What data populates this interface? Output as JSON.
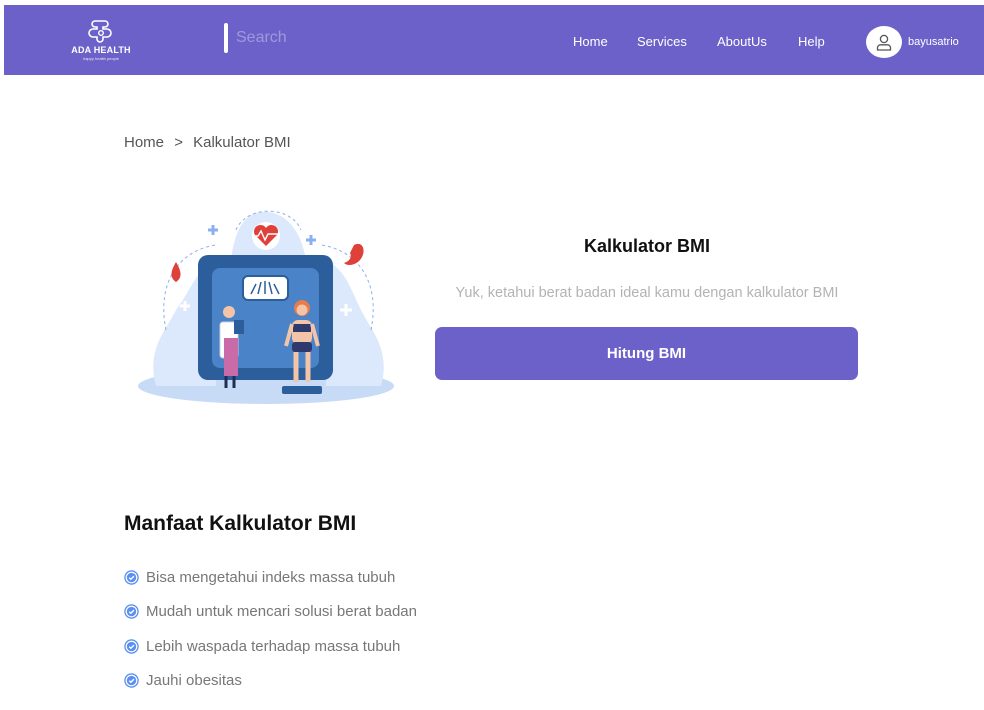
{
  "navbar": {
    "logo": {
      "name": "ADA HEALTH",
      "tagline": "happy health people"
    },
    "search": {
      "placeholder": "Search",
      "value": ""
    },
    "links": [
      {
        "label": "Home"
      },
      {
        "label": "Services"
      },
      {
        "label": "AboutUs"
      },
      {
        "label": "Help"
      }
    ],
    "user": {
      "name": "bayusatrio",
      "icon": "user-icon"
    }
  },
  "breadcrumb": {
    "home": "Home",
    "separator": ">",
    "current": "Kalkulator BMI"
  },
  "hero": {
    "title": "Kalkulator BMI",
    "subtitle": "Yuk, ketahui berat badan ideal kamu dengan kalkulator BMI",
    "button_label": "Hitung BMI"
  },
  "benefits": {
    "title": "Manfaat Kalkulator BMI",
    "items": [
      "Bisa mengetahui indeks massa tubuh",
      "Mudah untuk mencari solusi berat badan",
      "Lebih waspada terhadap massa tubuh",
      "Jauhi obesitas"
    ],
    "icon": "check-circle-icon"
  },
  "colors": {
    "primary": "#6b61c9",
    "muted_text": "#b3b3b3",
    "list_text": "#777777",
    "check": "#5b8ff0"
  }
}
